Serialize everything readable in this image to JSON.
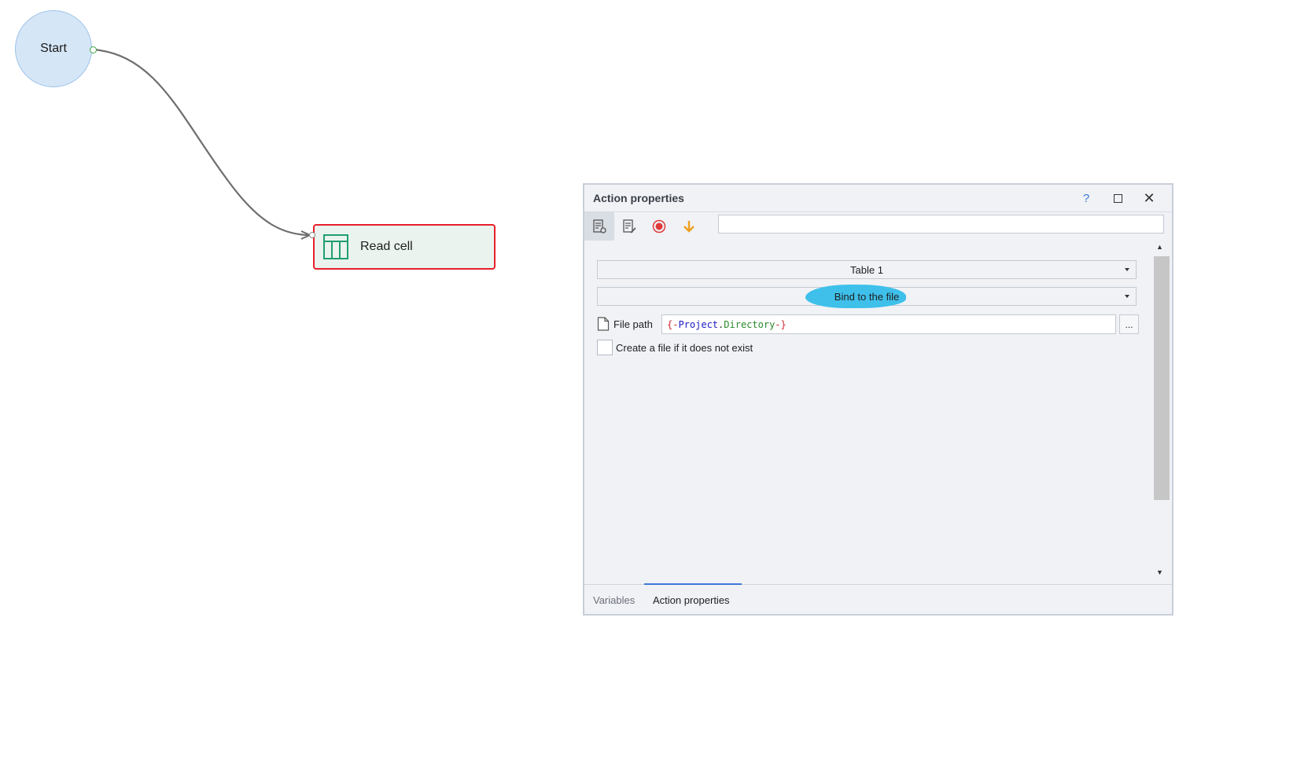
{
  "canvas": {
    "start_node": {
      "label": "Start"
    },
    "action_node": {
      "label": "Read cell",
      "icon": "table-icon",
      "border_color": "#e8202a"
    }
  },
  "panel": {
    "title": "Action properties",
    "header_buttons": {
      "help": "?",
      "maximize_icon": "maximize-icon",
      "close": "✕"
    },
    "toolbar": {
      "icons": [
        "properties-settings-icon",
        "edit-properties-icon",
        "record-icon",
        "arrow-down-icon"
      ],
      "search_value": ""
    },
    "table_select": {
      "value": "Table 1"
    },
    "bind_select": {
      "value": "Bind to the file"
    },
    "file_path": {
      "label": "File path",
      "value_parts": [
        "{-",
        "Project",
        ".",
        "Directory",
        "-}"
      ],
      "browse_label": "..."
    },
    "create_file_checkbox": {
      "label": "Create a file if it does not exist",
      "checked": false
    },
    "tabs": [
      {
        "label": "Variables",
        "active": false
      },
      {
        "label": "Action properties",
        "active": true
      }
    ],
    "accent_color": "#3c78d8",
    "highlight_color": "#3ec0ea"
  }
}
